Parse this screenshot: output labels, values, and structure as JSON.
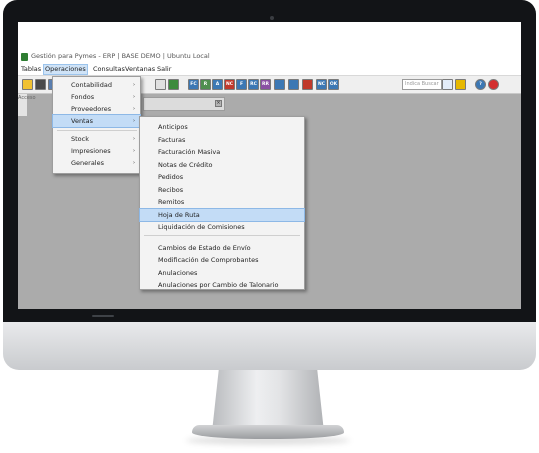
{
  "window": {
    "title": "Gestión para Pymes - ERP | BASE DEMO | Ubuntu Local"
  },
  "menubar": {
    "items": [
      {
        "label": "Tablas",
        "active": false
      },
      {
        "label": "Operaciones",
        "active": true
      },
      {
        "label": "Consultas",
        "active": false
      },
      {
        "label": "Ventanas",
        "active": false
      },
      {
        "label": "Salir",
        "active": false
      }
    ]
  },
  "toolbar": {
    "search_placeholder": "Indica Buscar",
    "buttons": [
      {
        "icon": "new-document-icon",
        "text": "",
        "color": "#f1c232"
      },
      {
        "icon": "grid-icon",
        "text": "",
        "color": "#4a4a4a"
      },
      {
        "icon": "table-icon",
        "text": "",
        "color": "#5b7fb0"
      },
      {
        "icon": "document-icon",
        "text": "",
        "color": "#e0e0e0"
      },
      {
        "icon": "zoom-icon",
        "text": "",
        "color": "#3d8b3d"
      },
      {
        "icon": "fc-icon",
        "text": "FC",
        "color": "#3c78b4"
      },
      {
        "icon": "r-icon",
        "text": "R",
        "color": "#4f8f4f"
      },
      {
        "icon": "a-icon",
        "text": "A",
        "color": "#3c78b4"
      },
      {
        "icon": "nc-icon",
        "text": "NC",
        "color": "#c0392b"
      },
      {
        "icon": "f-icon",
        "text": "F",
        "color": "#3c78b4"
      },
      {
        "icon": "rc-icon",
        "text": "RC",
        "color": "#3c78b4"
      },
      {
        "icon": "rr-icon",
        "text": "RR",
        "color": "#8a4fa3"
      },
      {
        "icon": "calc-icon",
        "text": "",
        "color": "#3c78b4"
      },
      {
        "icon": "chart-icon",
        "text": "",
        "color": "#3c78b4"
      },
      {
        "icon": "warning-icon",
        "text": "",
        "color": "#c0392b"
      },
      {
        "icon": "nc2-icon",
        "text": "NC",
        "color": "#3c78b4"
      },
      {
        "icon": "ok-icon",
        "text": "OK",
        "color": "#3c78b4"
      },
      {
        "icon": "search-icon",
        "text": "",
        "color": "#e3ecf8"
      },
      {
        "icon": "folder-icon",
        "text": "",
        "color": "#e6b800"
      },
      {
        "icon": "help-icon",
        "text": "?",
        "color": "#3c78b4"
      },
      {
        "icon": "close-icon",
        "text": "",
        "color": "#d32f2f"
      }
    ]
  },
  "left_panel": {
    "label": "Acceso"
  },
  "operaciones_menu": {
    "items": [
      {
        "label": "Contabilidad",
        "has_submenu": true,
        "highlighted": false
      },
      {
        "label": "Fondos",
        "has_submenu": true,
        "highlighted": false
      },
      {
        "label": "Proveedores",
        "has_submenu": true,
        "highlighted": false
      },
      {
        "label": "Ventas",
        "has_submenu": true,
        "highlighted": true
      },
      {
        "label": "Stock",
        "has_submenu": true,
        "highlighted": false
      },
      {
        "label": "Impresiones",
        "has_submenu": true,
        "highlighted": false
      },
      {
        "label": "Generales",
        "has_submenu": true,
        "highlighted": false
      }
    ]
  },
  "ventas_submenu": {
    "items": [
      {
        "label": "Anticipos",
        "highlighted": false
      },
      {
        "label": "Facturas",
        "highlighted": false
      },
      {
        "label": "Facturación Masiva",
        "highlighted": false
      },
      {
        "label": "Notas de Crédito",
        "highlighted": false
      },
      {
        "label": "Pedidos",
        "highlighted": false
      },
      {
        "label": "Recibos",
        "highlighted": false
      },
      {
        "label": "Remitos",
        "highlighted": false
      },
      {
        "label": "Hoja de Ruta",
        "highlighted": true
      },
      {
        "label": "Liquidación de Comisiones",
        "highlighted": false
      },
      {
        "label": "Cambios de Estado de Envío",
        "highlighted": false
      },
      {
        "label": "Modificación de Comprobantes",
        "highlighted": false
      },
      {
        "label": "Anulaciones",
        "highlighted": false
      },
      {
        "label": "Anulaciones por Cambio de Talonario",
        "highlighted": false
      }
    ]
  },
  "colors": {
    "workspace": "#ababab",
    "menu_highlight": "#c3dcf6",
    "bezel": "#121417"
  }
}
